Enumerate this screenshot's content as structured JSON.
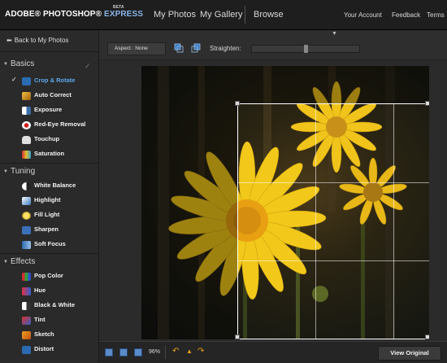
{
  "header": {
    "logo_main": "ADOBE® PHOTOSHOP®",
    "logo_express": "EXPRESS",
    "logo_beta": "BETA",
    "nav": [
      "My Photos",
      "My Gallery",
      "Browse"
    ],
    "right_nav": [
      "Your Account",
      "Feedback",
      "Terms"
    ]
  },
  "sidebar": {
    "back_label": "Back to My Photos",
    "sections": [
      {
        "title": "Basics",
        "items": [
          {
            "label": "Crop & Rotate",
            "icon": "crop-icon"
          },
          {
            "label": "Auto Correct",
            "icon": "magic-wand-icon"
          },
          {
            "label": "Exposure",
            "icon": "exposure-icon"
          },
          {
            "label": "Red-Eye Removal",
            "icon": "red-eye-icon"
          },
          {
            "label": "Touchup",
            "icon": "hand-icon"
          },
          {
            "label": "Saturation",
            "icon": "saturation-icon"
          }
        ]
      },
      {
        "title": "Tuning",
        "items": [
          {
            "label": "White Balance",
            "icon": "white-balance-icon"
          },
          {
            "label": "Highlight",
            "icon": "highlight-icon"
          },
          {
            "label": "Fill Light",
            "icon": "bulb-icon"
          },
          {
            "label": "Sharpen",
            "icon": "sharpen-icon"
          },
          {
            "label": "Soft Focus",
            "icon": "soft-focus-icon"
          }
        ]
      },
      {
        "title": "Effects",
        "items": [
          {
            "label": "Pop Color",
            "icon": "pop-color-icon"
          },
          {
            "label": "Hue",
            "icon": "hue-icon"
          },
          {
            "label": "Black & White",
            "icon": "black-white-icon"
          },
          {
            "label": "Tint",
            "icon": "tint-icon"
          },
          {
            "label": "Sketch",
            "icon": "pencil-icon"
          },
          {
            "label": "Distort",
            "icon": "distort-icon"
          }
        ]
      }
    ]
  },
  "toolbar": {
    "aspect_label": "Aspect : None",
    "straighten_label": "Straighten:",
    "straighten_value": 0.5
  },
  "bottom": {
    "zoom": "96%",
    "view_original": "View Original"
  },
  "colors": {
    "selected": "#5ea8ee",
    "accent_orange": "#e8a020"
  }
}
